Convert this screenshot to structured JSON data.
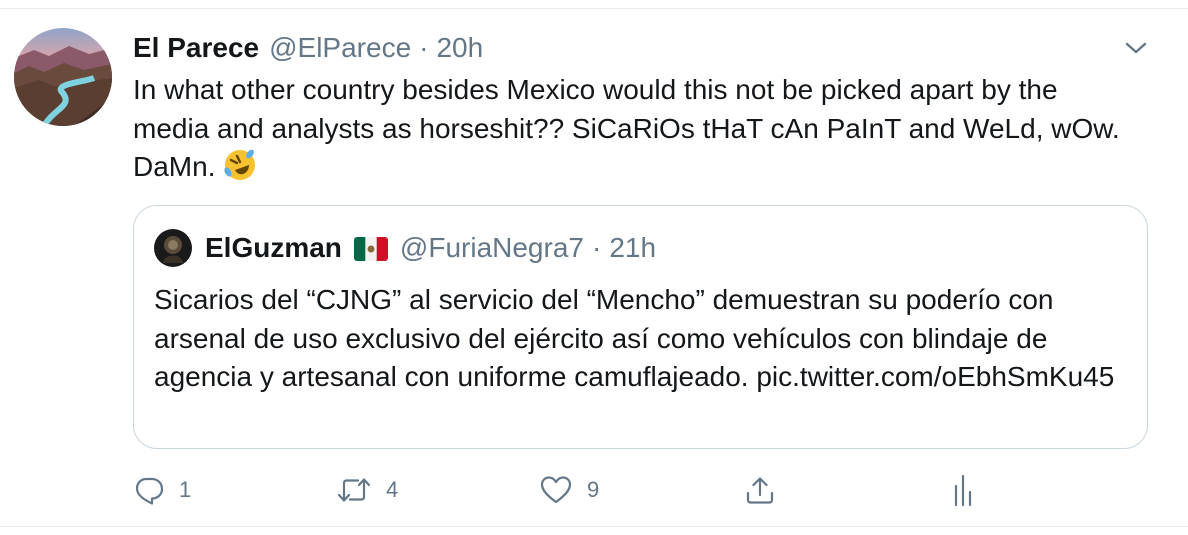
{
  "tweet": {
    "display_name": "El Parece",
    "handle": "@ElParece",
    "separator": "·",
    "time": "20h",
    "text": "In what other country besides Mexico would this not be picked apart by the media and analysts as horseshit?? SiCaRiOs tHaT cAn PaInT and WeLd, wOw. DaMn. ",
    "emoji": "rolling-on-floor-laughing",
    "menu_icon": "chevron-down-icon"
  },
  "quoted": {
    "display_name": "ElGuzman",
    "flag": "mexico-flag",
    "handle": "@FuriaNegra7",
    "separator": "·",
    "time": "21h",
    "text": "Sicarios del “CJNG” al servicio del “Mencho” demuestran su poderío con arsenal de uso exclusivo del ejército así como vehículos con blindaje de agencia y artesanal con uniforme camuflajeado. pic.twitter.com/oEbhSmKu45"
  },
  "actions": {
    "reply_count": "1",
    "retweet_count": "4",
    "like_count": "9"
  },
  "colors": {
    "text": "#14171a",
    "secondary": "#657786",
    "border": "#ccd6dd"
  }
}
